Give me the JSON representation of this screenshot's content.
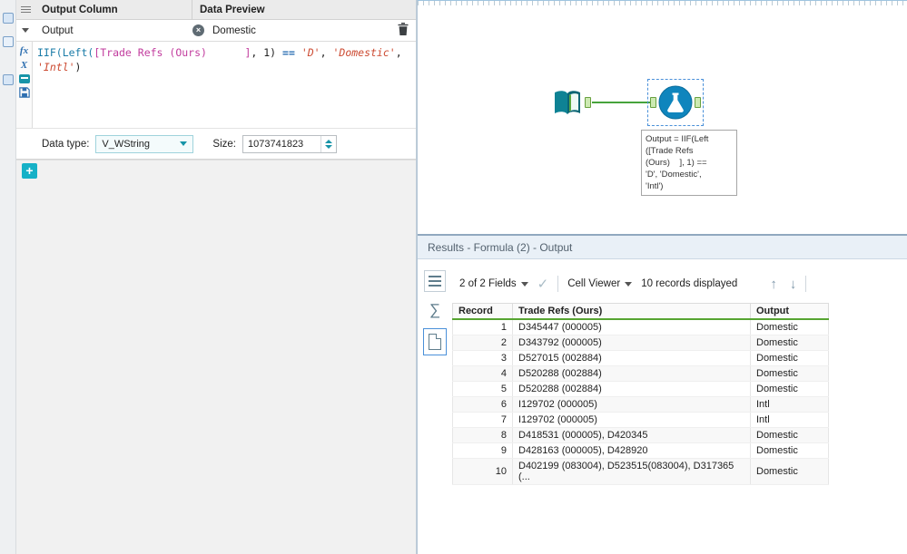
{
  "colors": {
    "accent_teal": "#16b1c7",
    "connector_green": "#46a33c",
    "selection_blue": "#4a90d9",
    "table_header_green": "#57a531"
  },
  "icons": {
    "clear": "×",
    "check": "✓",
    "up_arrow": "↑",
    "down_arrow": "↓",
    "sigma": "∑",
    "fx": "fx",
    "x_var": "X"
  },
  "config": {
    "header": {
      "output_column": "Output Column",
      "data_preview": "Data Preview"
    },
    "field_row": {
      "name": "Output",
      "preview": "Domestic"
    },
    "expression_lines": [
      [
        {
          "t": "IIF(Left(",
          "c": "func"
        },
        {
          "t": "[Trade Refs (Ours)      ]",
          "c": "field"
        },
        {
          "t": ", 1) ",
          "c": "plain"
        },
        {
          "t": "==",
          "c": "op"
        },
        {
          "t": " ",
          "c": "plain"
        },
        {
          "t": "'D'",
          "c": "str"
        },
        {
          "t": ", ",
          "c": "plain"
        },
        {
          "t": "'Domestic'",
          "c": "str"
        },
        {
          "t": ",",
          "c": "plain"
        }
      ],
      [
        {
          "t": "'Intl'",
          "c": "str"
        },
        {
          "t": ")",
          "c": "plain"
        }
      ]
    ],
    "data_type": {
      "label": "Data type:",
      "value": "V_WString",
      "size_label": "Size:",
      "size_value": "1073741823"
    },
    "add_button": "+"
  },
  "canvas": {
    "annotation_lines": [
      "Output = IIF(Left",
      "([Trade Refs",
      "(Ours)    ], 1) ==",
      "'D', 'Domestic',",
      "'Intl')"
    ]
  },
  "results": {
    "title": "Results - Formula (2) - Output",
    "toolbar": {
      "fields": "2 of 2 Fields",
      "cell_viewer": "Cell Viewer",
      "records": "10 records displayed"
    },
    "table": {
      "headers": [
        "Record",
        "Trade Refs (Ours)",
        "Output"
      ],
      "rows": [
        [
          "1",
          "D345447 (000005)",
          "Domestic"
        ],
        [
          "2",
          "D343792 (000005)",
          "Domestic"
        ],
        [
          "3",
          "D527015 (002884)",
          "Domestic"
        ],
        [
          "4",
          "D520288 (002884)",
          "Domestic"
        ],
        [
          "5",
          "D520288 (002884)",
          "Domestic"
        ],
        [
          "6",
          "I129702 (000005)",
          "Intl"
        ],
        [
          "7",
          "I129702 (000005)",
          "Intl"
        ],
        [
          "8",
          "D418531 (000005), D420345",
          "Domestic"
        ],
        [
          "9",
          "D428163 (000005), D428920",
          "Domestic"
        ],
        [
          "10",
          "D402199 (083004), D523515(083004), D317365 (...",
          "Domestic"
        ]
      ]
    }
  }
}
